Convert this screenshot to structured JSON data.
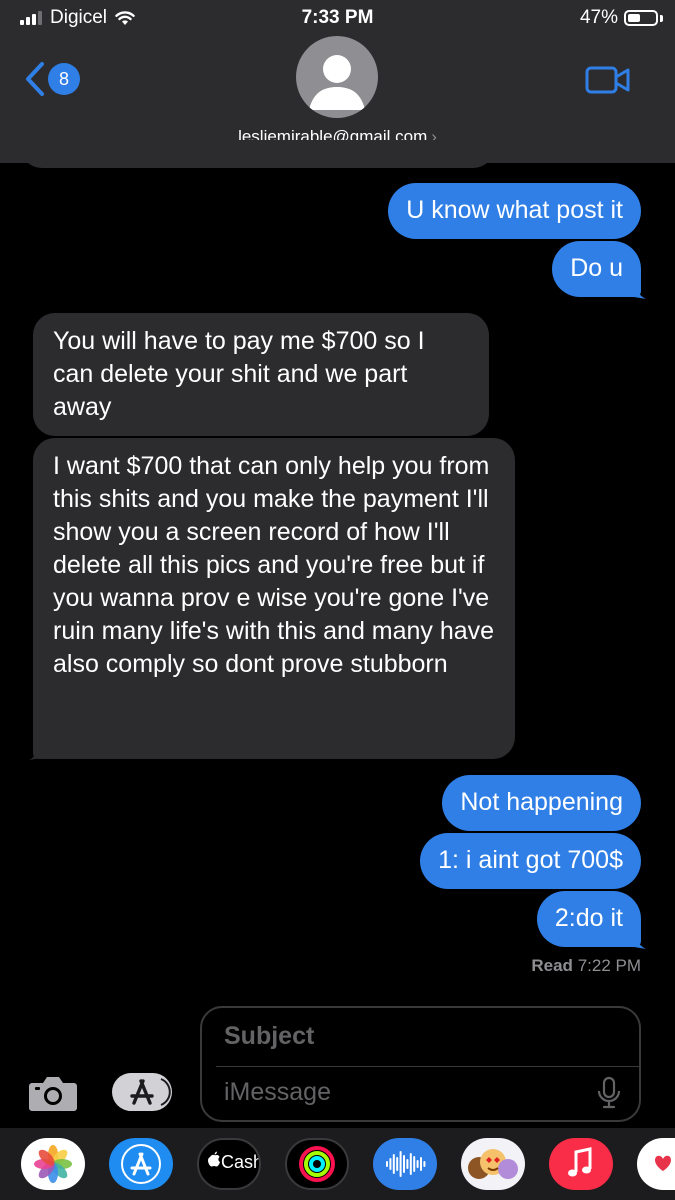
{
  "status_bar": {
    "carrier": "Digicel",
    "time": "7:33 PM",
    "battery_percent": "47%",
    "battery_level": 0.47,
    "signal_icon": "signal-bars-icon",
    "wifi_icon": "wifi-icon"
  },
  "header": {
    "back_badge": "8",
    "back_icon": "chevron-left-icon",
    "contact": "lesliemirable@gmail.com",
    "contact_chevron": "›",
    "video_icon": "video-camera-icon"
  },
  "messages": [
    {
      "from": "me",
      "text": "U know what post it"
    },
    {
      "from": "me",
      "text": "Do u"
    },
    {
      "from": "them",
      "text": "You will have to pay me $700 so I can delete your shit and we part away"
    },
    {
      "from": "them",
      "text": "I want $700 that can only help you from this shits and you make the payment I'll show you a screen record of how I'll delete all this pics and you're free but if you wanna prov e wise you're gone  I've ruin many life's with this and many have also comply so dont prove stubborn"
    },
    {
      "from": "me",
      "text": "Not happening"
    },
    {
      "from": "me",
      "text": "1: i aint got 700$"
    },
    {
      "from": "me",
      "text": "2:do it"
    }
  ],
  "read_receipt": {
    "label": "Read",
    "time": "7:22 PM"
  },
  "compose": {
    "subject_placeholder": "Subject",
    "message_placeholder": "iMessage",
    "camera_icon": "camera-icon",
    "apps_icon": "app-store-icon",
    "mic_icon": "microphone-icon"
  },
  "app_drawer": {
    "cash_label": "Cash",
    "apps": [
      "photos-icon",
      "app-store-icon",
      "apple-cash-icon",
      "activity-icon",
      "audio-message-icon",
      "memoji-icon",
      "music-icon",
      "hashtag-images-icon"
    ]
  },
  "colors": {
    "outgoing_bubble": "#2f7fe6",
    "incoming_bubble": "#2c2c2e",
    "header_bg": "#2c2c2e",
    "background": "#000000"
  }
}
